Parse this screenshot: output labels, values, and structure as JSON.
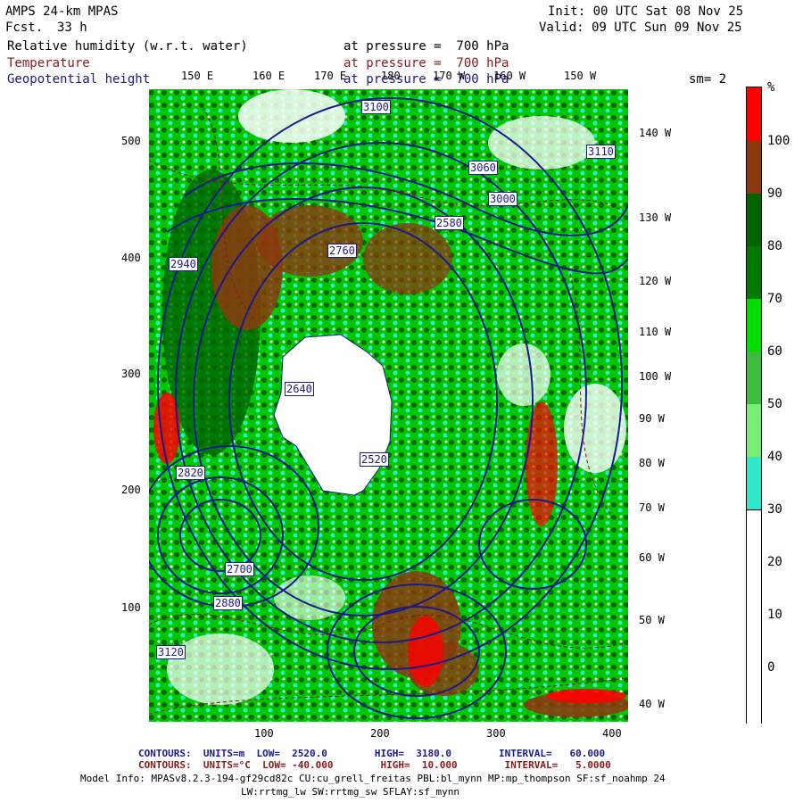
{
  "header": {
    "model": "AMPS 24-km MPAS",
    "fcst_label": "Fcst.",
    "fcst_value": "33 h",
    "init": "Init: 00 UTC Sat 08 Nov 25",
    "valid": "Valid: 09 UTC Sun 09 Nov 25"
  },
  "fields": [
    {
      "name": "Relative humidity (w.r.t. water)",
      "level": "at pressure =  700 hPa",
      "color": "#000000"
    },
    {
      "name": "Temperature",
      "level": "at pressure =  700 hPa",
      "color": "#8b1a1a"
    },
    {
      "name": "Geopotential height",
      "level": "at pressure =  700 hPa",
      "color": "#1a1a8c"
    }
  ],
  "smoothing": "sm= 2",
  "top_lon_labels": [
    "150 E",
    "160 E",
    "170 E",
    "180",
    "170 W",
    "160 W",
    "150 W"
  ],
  "right_lon_labels": [
    "140 W",
    "130 W",
    "120 W",
    "110 W",
    "100 W",
    "90 W",
    "80 W",
    "70 W",
    "60 W",
    "50 W",
    "40 W"
  ],
  "y_ticks": [
    "500",
    "400",
    "300",
    "200",
    "100"
  ],
  "x_ticks": [
    "100",
    "200",
    "300",
    "400"
  ],
  "legend": {
    "unit": "%",
    "labels": [
      "100",
      "90",
      "80",
      "70",
      "60",
      "50",
      "40",
      "30",
      "20",
      "10",
      "0"
    ],
    "colors": [
      "#ff0000",
      "#8b3a0f",
      "#006400",
      "#007a00",
      "#00dd00",
      "#3dbb3d",
      "#77ee77",
      "#33e8c8",
      "#ffffff",
      "#ffffff",
      "#ffffff",
      "#ffffff"
    ]
  },
  "height_labels": [
    "3100",
    "3060",
    "3000",
    "2940",
    "2880",
    "2820",
    "2760",
    "2700",
    "2640",
    "2580",
    "2520",
    "3120",
    "3110"
  ],
  "footer": {
    "contours_1": "CONTOURS:  UNITS=m  LOW=  2520.0        HIGH=  3180.0        INTERVAL=   60.000",
    "contours_2": "CONTOURS:  UNITS=°C  LOW= -40.000        HIGH=  10.000        INTERVAL=   5.0000",
    "model_info_1": "Model Info: MPASv8.2.3-194-gf29cd82c CU:cu_grell_freitas PBL:bl_mynn MP:mp_thompson SF:sf_noahmp 24",
    "model_info_2": "LW:rrtmg_lw SW:rrtmg_sw SFLAY:sf_mynn"
  }
}
